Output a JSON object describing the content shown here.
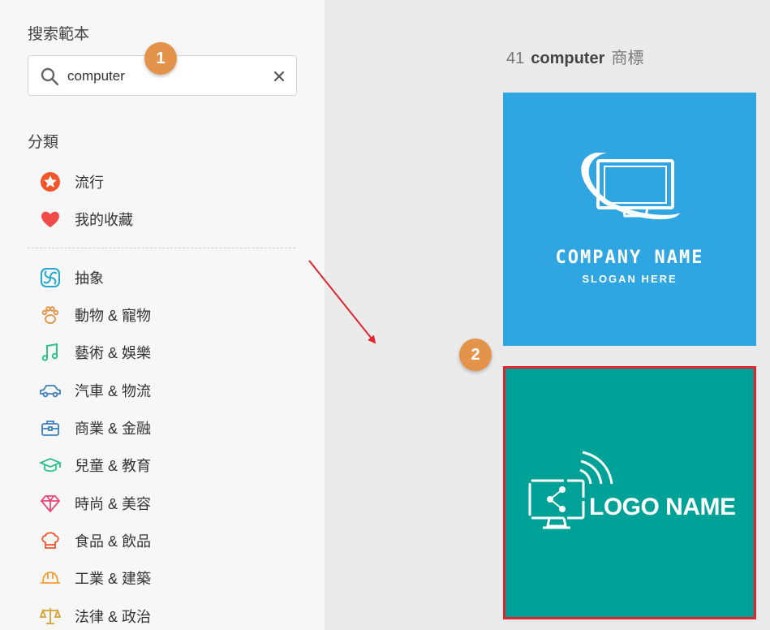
{
  "sidebar": {
    "search_title": "搜索範本",
    "search": {
      "value": "computer"
    },
    "category_title": "分類",
    "pinned": [
      {
        "label": "流行",
        "icon": "star-badge-icon"
      },
      {
        "label": "我的收藏",
        "icon": "heart-icon"
      }
    ],
    "categories": [
      {
        "label": "抽象",
        "icon": "abstract-swirl-icon"
      },
      {
        "label": "動物 & 寵物",
        "icon": "paw-icon"
      },
      {
        "label": "藝術 & 娛樂",
        "icon": "music-note-icon"
      },
      {
        "label": "汽車 & 物流",
        "icon": "car-icon"
      },
      {
        "label": "商業 & 金融",
        "icon": "briefcase-icon"
      },
      {
        "label": "兒童 & 教育",
        "icon": "graduation-cap-icon"
      },
      {
        "label": "時尚 & 美容",
        "icon": "diamond-icon"
      },
      {
        "label": "食品 & 飲品",
        "icon": "chef-hat-icon"
      },
      {
        "label": "工業 & 建築",
        "icon": "hard-hat-icon"
      },
      {
        "label": "法律 & 政治",
        "icon": "scales-icon"
      }
    ]
  },
  "annotations": {
    "step1": "1",
    "step2": "2"
  },
  "results": {
    "count": "41",
    "term": "computer",
    "suffix": "商標",
    "cards": [
      {
        "name": "COMPANY NAME",
        "slogan": "SLOGAN HERE",
        "bg": "#2fa6e2"
      },
      {
        "name": "LOGO NAME",
        "bg": "#00a297",
        "selected": true
      }
    ]
  },
  "colors": {
    "annotation": "#e4934a",
    "selection": "#e0262c"
  }
}
